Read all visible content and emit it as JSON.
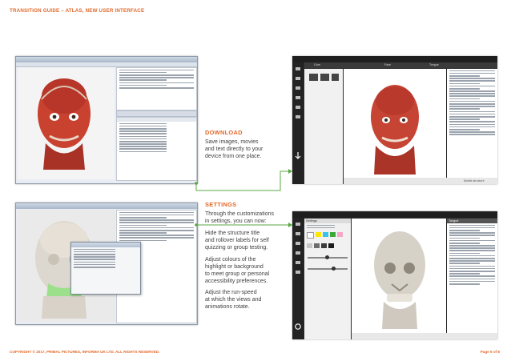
{
  "header": {
    "title": "TRANSITION GUIDE – ATLAS, NEW USER INTERFACE"
  },
  "download": {
    "heading": "DOWNLOAD",
    "lines": [
      "Save images, movies",
      "and text directly to your",
      "device from one place."
    ]
  },
  "settings": {
    "heading": "SETTINGS",
    "intro": [
      "Through the customizations",
      "in settings, you can now:"
    ],
    "bullets": [
      [
        "Hide the structure title",
        "and rollover labels for self",
        "quizzing or group testing."
      ],
      [
        "Adjust colours of the",
        "highlight or background",
        "to meet group or personal",
        "accessibility preferences."
      ],
      [
        "Adjust the run-speed",
        "at which the views and",
        "animations rotate."
      ]
    ]
  },
  "screens": {
    "new_ui_tabs": [
      "Gum",
      "Face",
      "Tongue"
    ],
    "new_ui_status": "Mobile structure",
    "new_settings_title": "Settings",
    "new_settings_panel": "Tongue"
  },
  "colors": {
    "accent": "#e2682a",
    "connector": "#5aa844",
    "swatches": [
      "#ffffff",
      "#ffe600",
      "#36c3e8",
      "#3aa935",
      "#f3a6c8",
      "#c8c8c8",
      "#6d6d6d",
      "#3b3b3b",
      "#1c1c1c"
    ]
  },
  "footer": {
    "copyright": "COPYRIGHT © 2017, PRIMAL PICTURES, INFORMA UK LTD. ALL RIGHTS RESERVED.",
    "page": "Page 6 of 8"
  }
}
